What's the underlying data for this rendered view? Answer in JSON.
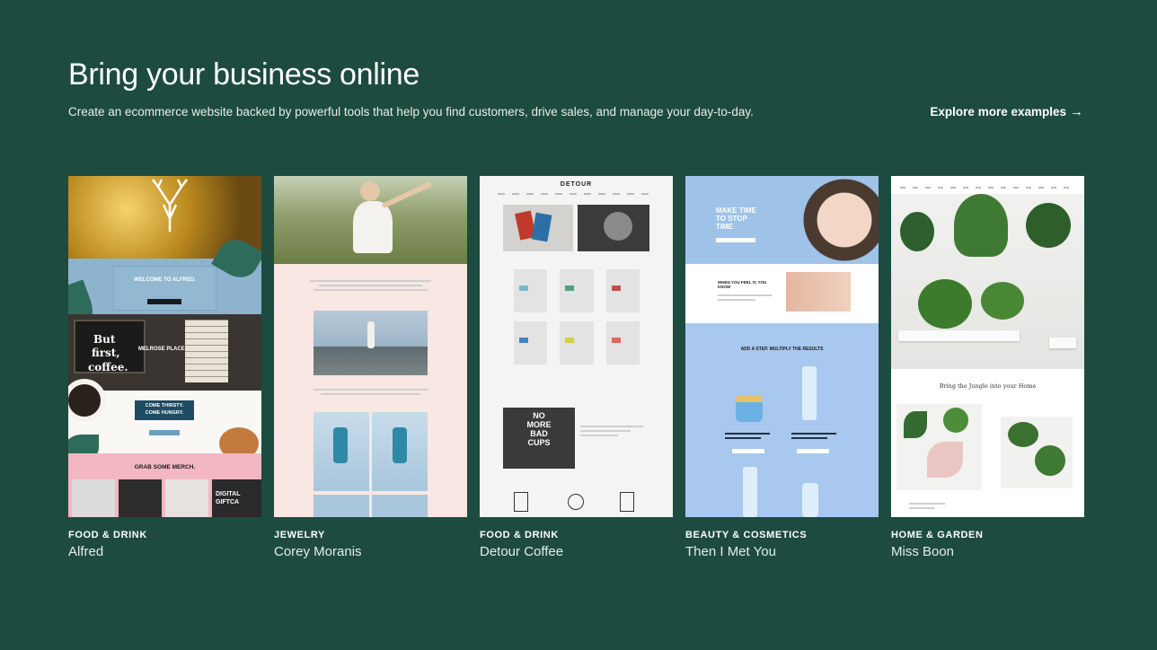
{
  "header": {
    "title": "Bring your business online",
    "subtitle": "Create an ecommerce website backed by powerful tools that help you find customers, drive sales, and manage your day-to-day.",
    "explore_label": "Explore more examples",
    "explore_icon": "arrow-right-icon"
  },
  "cards": [
    {
      "category": "FOOD & DRINK",
      "name": "Alfred",
      "preview": {
        "welcome": "WELCOME TO ALFRED.",
        "slogan_1": "But",
        "slogan_2": "first,",
        "slogan_3": "coffee.",
        "location": "MELROSE PLACE",
        "promo_1": "COME THIRSTY.",
        "promo_2": "COME HUNGRY.",
        "merch": "GRAB SOME MERCH.",
        "gift": "DIGITAL GIFTCA"
      }
    },
    {
      "category": "JEWELRY",
      "name": "Corey Moranis",
      "preview": {}
    },
    {
      "category": "FOOD & DRINK",
      "name": "Detour Coffee",
      "preview": {
        "brand": "DETOUR",
        "promo_1": "NO",
        "promo_2": "MORE",
        "promo_3": "BAD",
        "promo_4": "CUPS"
      }
    },
    {
      "category": "BEAUTY & COSMETICS",
      "name": "Then I Met You",
      "preview": {
        "headline_1": "MAKE TIME",
        "headline_2": "TO STOP",
        "headline_3": "TIME",
        "when": "WHEN YOU FEEL IT, YOU KNOW",
        "steps": "ADD A STEP. MULTIPLY THE RESULTS"
      }
    },
    {
      "category": "HOME & GARDEN",
      "name": "Miss Boon",
      "preview": {
        "tagline": "Bring the Jungle into your Home"
      }
    }
  ],
  "colors": {
    "background": "#1d4b3f",
    "text": "#ffffff"
  }
}
